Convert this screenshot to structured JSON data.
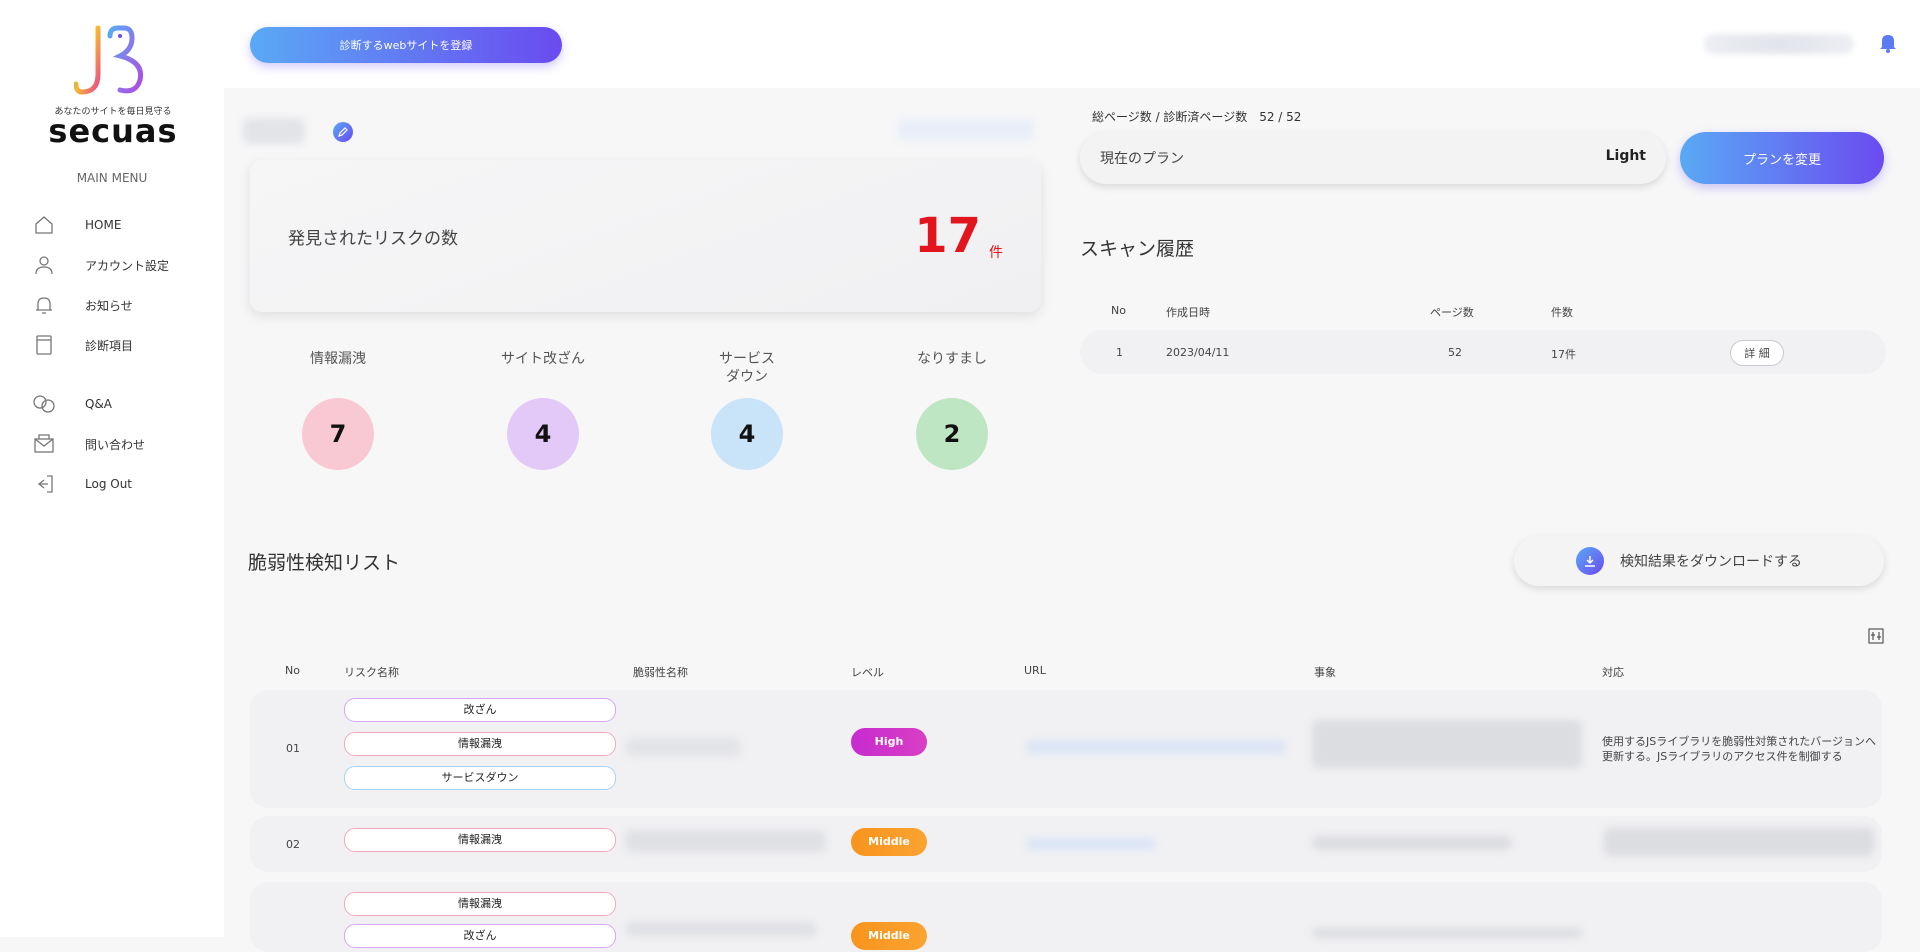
{
  "brand": {
    "tagline": "あなたのサイトを毎日見守る",
    "name": "secuas"
  },
  "sidebar": {
    "menu_title": "MAIN MENU",
    "items": [
      {
        "label": "HOME",
        "icon": "home-icon"
      },
      {
        "label": "アカウント設定",
        "icon": "user-icon"
      },
      {
        "label": "お知らせ",
        "icon": "bell-icon"
      },
      {
        "label": "診断項目",
        "icon": "clipboard-icon"
      },
      {
        "label": "Q&A",
        "icon": "chat-icon"
      },
      {
        "label": "問い合わせ",
        "icon": "mail-icon"
      },
      {
        "label": "Log Out",
        "icon": "logout-icon"
      }
    ]
  },
  "topbar": {
    "register_label": "診断するwebサイトを登録",
    "accent_start": "#5aa9f5",
    "accent_end": "#6a4bf0"
  },
  "summary": {
    "risk_title": "発見されたリスクの数",
    "risk_count": "17",
    "risk_unit": "件",
    "risk_color": "#e3151c",
    "categories": [
      {
        "label": "情報漏洩",
        "count": "7",
        "color": "#f9c9d3"
      },
      {
        "label": "サイト改ざん",
        "count": "4",
        "color": "#e2c9f7"
      },
      {
        "label": "サービス\nダウン",
        "count": "4",
        "color": "#c9e3f9"
      },
      {
        "label": "なりすまし",
        "count": "2",
        "color": "#bfe6c3"
      }
    ]
  },
  "plan": {
    "pages_text": "総ページ数 / 診断済ページ数　52 / 52",
    "current_plan_label": "現在のプラン",
    "current_plan_value": "Light",
    "change_label": "プランを変更"
  },
  "scan_history": {
    "title": "スキャン履歴",
    "headers": [
      "No",
      "作成日時",
      "ページ数",
      "件数"
    ],
    "rows": [
      {
        "no": "1",
        "date": "2023/04/11",
        "pages": "52",
        "count": "17件",
        "action": "詳 細"
      }
    ]
  },
  "vuln_list": {
    "title": "脆弱性検知リスト",
    "download_label": "検知結果をダウンロードする",
    "headers": [
      "No",
      "リスク名称",
      "脆弱性名称",
      "レベル",
      "URL",
      "事象",
      "対応"
    ],
    "rows": [
      {
        "no": "01",
        "risks": [
          "改ざん",
          "情報漏洩",
          "サービスダウン"
        ],
        "level": "High",
        "response": "使用するJSライブラリを脆弱性対策されたバージョンへ更新する。JSライブラリのアクセス件を制御する"
      },
      {
        "no": "02",
        "risks": [
          "情報漏洩"
        ],
        "level": "Middle",
        "response": ""
      },
      {
        "no": "",
        "risks": [
          "情報漏洩",
          "改ざん"
        ],
        "level": "Middle",
        "response": ""
      }
    ],
    "level_colors": {
      "High": "#c72bd0",
      "Middle": "#f7941d"
    }
  }
}
